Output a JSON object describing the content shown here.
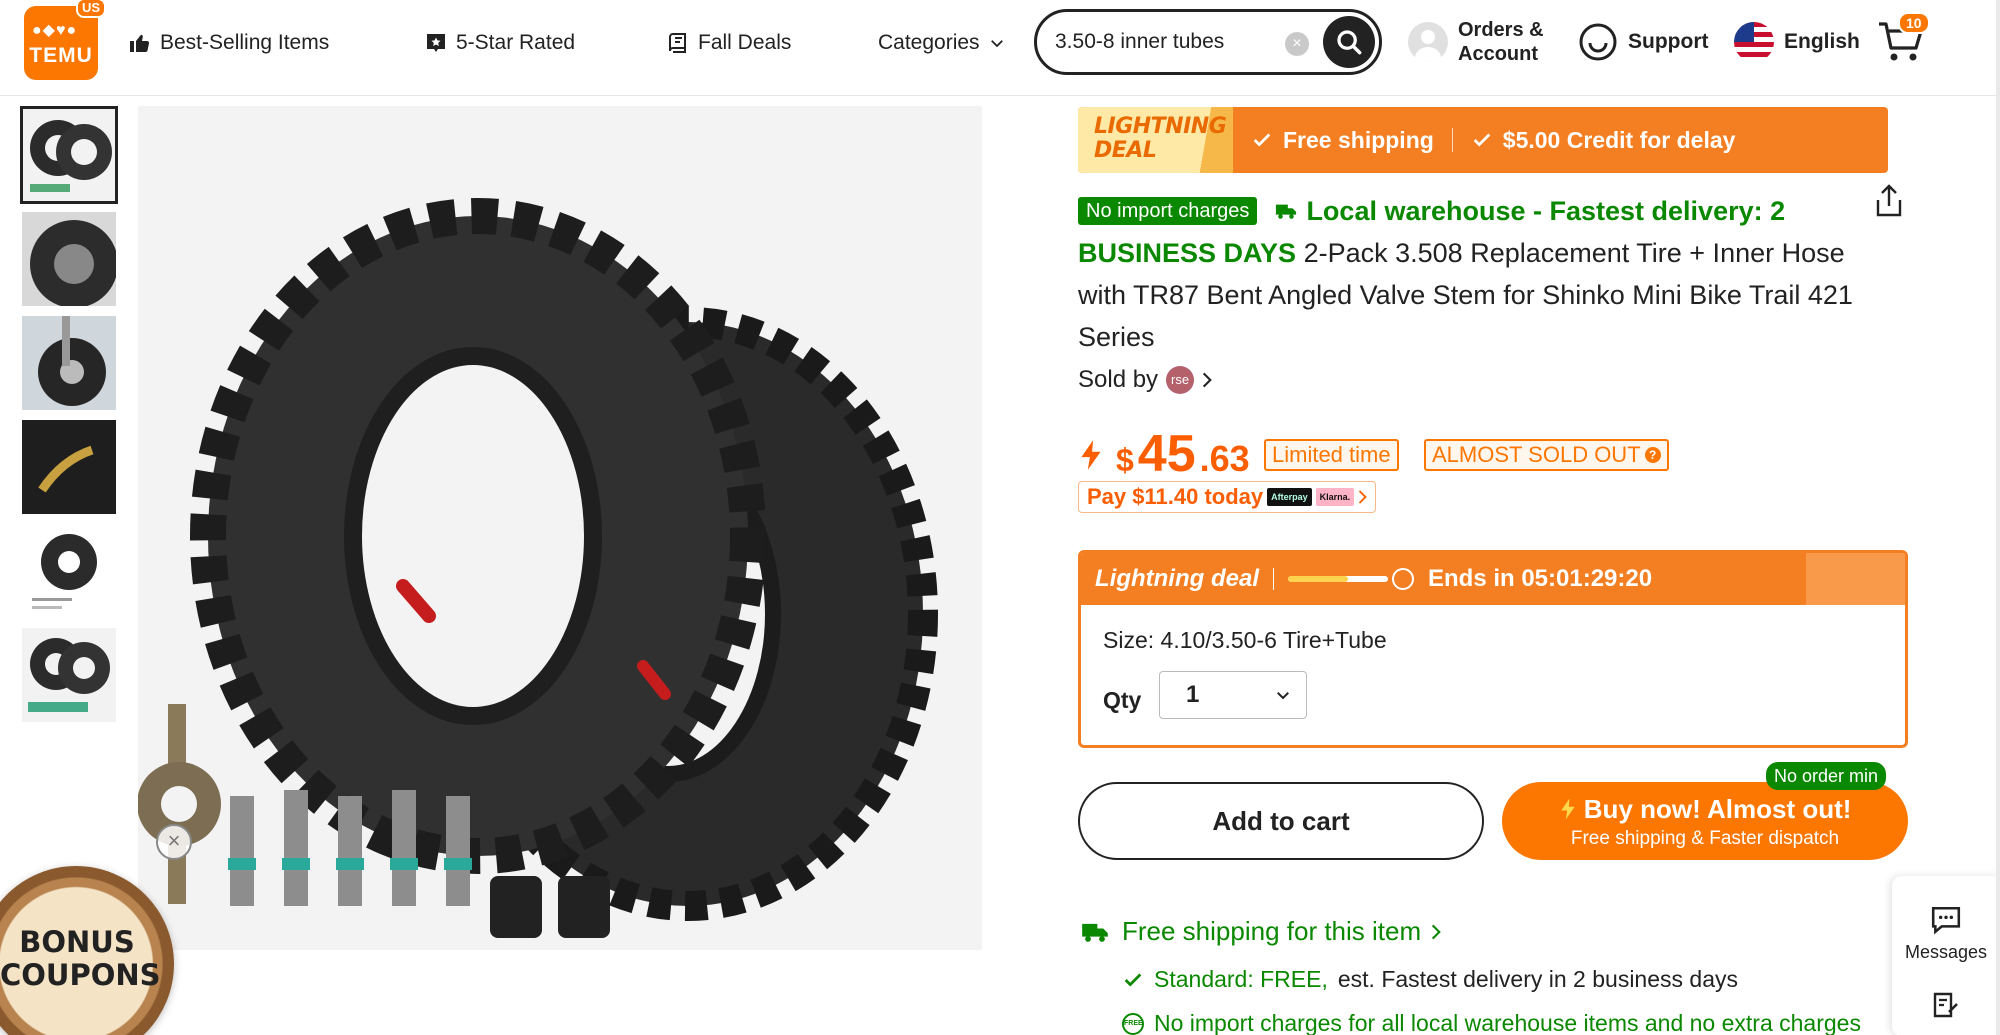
{
  "header": {
    "logo": {
      "text": "TEMU",
      "region_badge": "US",
      "brand_color": "#fb7701"
    },
    "nav": [
      {
        "label": "Best-Selling Items",
        "icon": "thumbs-up-icon"
      },
      {
        "label": "5-Star Rated",
        "icon": "star-badge-icon"
      },
      {
        "label": "Fall Deals",
        "icon": "leaf-icon"
      },
      {
        "label": "Categories",
        "icon": "chevron-down-icon"
      }
    ],
    "search": {
      "value": "3.50-8 inner tubes",
      "placeholder": "Search"
    },
    "account_label": "Orders & Account",
    "support_label": "Support",
    "language_label": "English",
    "cart_count": "10"
  },
  "gallery": {
    "thumbnail_count": 6,
    "active_index": 0,
    "bonus_coupons": "BONUS COUPONS"
  },
  "product": {
    "lightning_banner": {
      "logo_text": "LIGHTNING DEAL",
      "items": [
        "Free shipping",
        "$5.00 Credit for delay"
      ]
    },
    "no_import_badge": "No import charges",
    "local_warehouse": "Local warehouse - Fastest delivery: 2 BUSINESS DAYS",
    "title": "2-Pack 3.508 Replacement Tire + Inner Hose with TR87 Bent Angled Valve Stem for Shinko Mini Bike Trail 421 Series",
    "sold_by_label": "Sold by",
    "seller_avatar_text": "rse",
    "price": {
      "currency": "$",
      "dollars": "45",
      "cents": ".63"
    },
    "tags": [
      "Limited time",
      "ALMOST SOLD OUT"
    ],
    "pay_today": "Pay $11.40 today",
    "pay_partners": [
      "Afterpay",
      "Klarna."
    ],
    "deal": {
      "title": "Lightning deal",
      "progress": 0.6,
      "ends_in": "Ends in 05:01:29:20",
      "size_text": "Size: 4.10/3.50-6 Tire+Tube",
      "qty_label": "Qty",
      "qty_value": "1"
    },
    "add_to_cart": "Add to cart",
    "buy_now": {
      "main": "Buy now! Almost out!",
      "sub": "Free shipping & Faster dispatch"
    },
    "no_order_min": "No order min",
    "shipping": {
      "title": "Free shipping for this item",
      "standard_prefix": "Standard: FREE,",
      "standard_rest": "est. Fastest delivery in 2 business days",
      "import_note": "No import charges for all local warehouse items and no extra charges",
      "free_icon_text": "FREE"
    }
  },
  "side_rail": {
    "messages_label": "Messages"
  },
  "colors": {
    "accent": "#fb7701",
    "price": "#fb5d01",
    "green": "#0a8800"
  }
}
